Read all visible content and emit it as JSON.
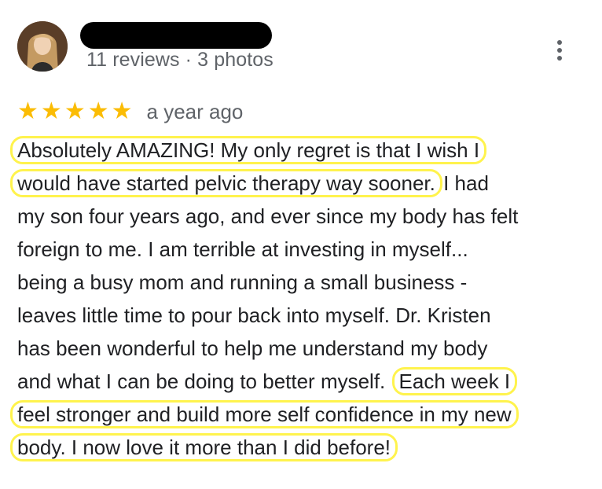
{
  "reviewer": {
    "avatar_icon": "profile-photo",
    "name_redacted": true,
    "meta": "11 reviews · 3 photos"
  },
  "menu": {
    "icon": "more-vert-icon"
  },
  "rating": {
    "stars": 5,
    "star_glyph": "★",
    "date": "a year ago",
    "star_color": "#fbbc04"
  },
  "review": {
    "line1_hl": "Absolutely AMAZING! My only regret is that I wish I",
    "line2_hl": "would have started pelvic therapy way sooner.",
    "line2_rest": " I had",
    "line3": "my son four years ago, and ever since my body has felt",
    "line4": "foreign to me. I am terrible at investing in myself...",
    "line5": "being a busy mom and running a small business -",
    "line6": "leaves little time to pour back into myself. Dr. Kristen",
    "line7": "has been wonderful to help me understand my body",
    "line8_start": "and what I can be doing to better myself. ",
    "line8_hl": "Each week I",
    "line9_hl": "feel stronger and build more self confidence in my new",
    "line10_hl": "body. I now love it more than I did before!",
    "highlight_color": "#fff34d"
  }
}
